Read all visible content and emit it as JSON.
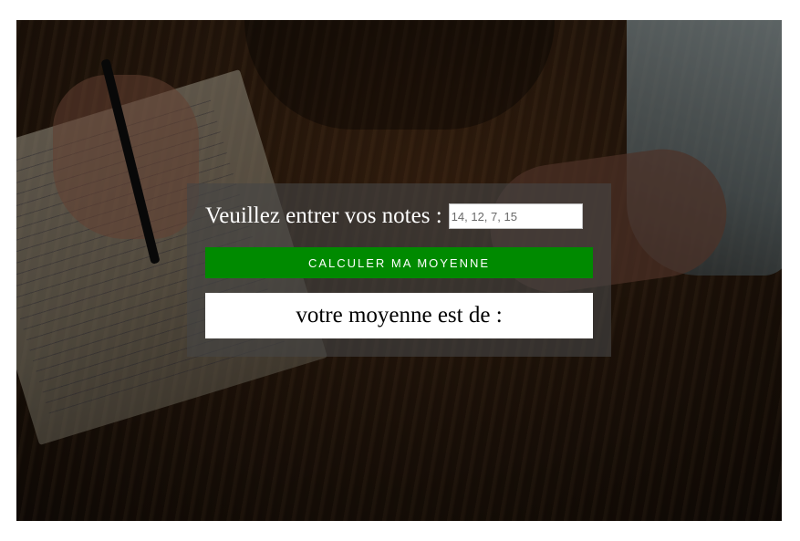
{
  "form": {
    "prompt_label": "Veuillez entrer vos notes :",
    "notes_input": {
      "value": "",
      "placeholder": "14, 12, 7, 15"
    },
    "calculate_button_label": "CALCULER MA MOYENNE",
    "result_text": "votre moyenne est de :"
  },
  "colors": {
    "button_background": "#008a00",
    "panel_background": "rgba(70,70,70,0.62)"
  }
}
